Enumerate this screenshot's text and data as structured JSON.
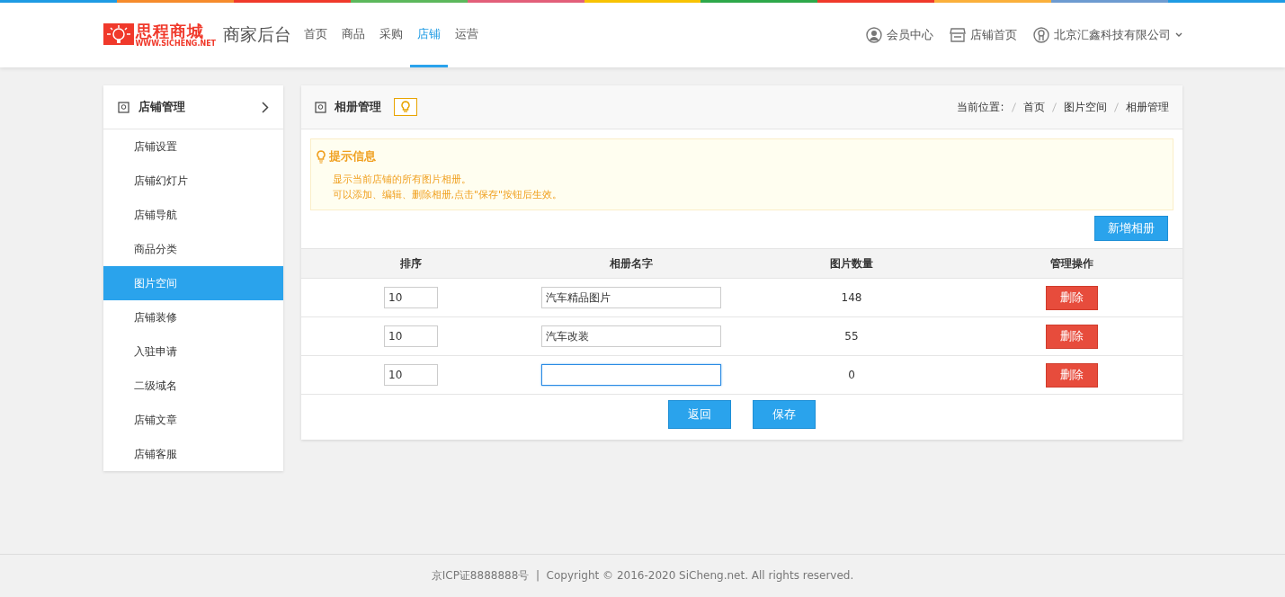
{
  "top_nav": {
    "logo": {
      "name": "思程商城",
      "url": "WWW.SICHENG.NET"
    },
    "title": "商家后台",
    "items": [
      {
        "label": "首页",
        "selected": false
      },
      {
        "label": "商品",
        "selected": false
      },
      {
        "label": "采购",
        "selected": false
      },
      {
        "label": "店铺",
        "selected": true
      },
      {
        "label": "运营",
        "selected": false
      }
    ],
    "links": [
      {
        "kind": "user",
        "label": "会员中心"
      },
      {
        "kind": "store",
        "label": "店铺首页"
      },
      {
        "kind": "account",
        "label": "北京汇鑫科技有限公司"
      }
    ]
  },
  "sidebar": {
    "title": "店铺管理",
    "items": [
      {
        "label": "店铺设置",
        "selected": false
      },
      {
        "label": "店铺幻灯片",
        "selected": false
      },
      {
        "label": "店铺导航",
        "selected": false
      },
      {
        "label": "商品分类",
        "selected": false
      },
      {
        "label": "图片空间",
        "selected": true
      },
      {
        "label": "店铺装修",
        "selected": false
      },
      {
        "label": "入驻申请",
        "selected": false
      },
      {
        "label": "二级域名",
        "selected": false
      },
      {
        "label": "店铺文章",
        "selected": false
      },
      {
        "label": "店铺客服",
        "selected": false
      }
    ]
  },
  "panel": {
    "title": "相册管理",
    "breadcrumb": {
      "label": "当前位置:",
      "items": [
        "首页",
        "图片空间",
        "相册管理"
      ]
    },
    "tips": {
      "title": "提示信息",
      "lines": [
        "显示当前店铺的所有图片相册。",
        "可以添加、编辑、删除相册,点击\"保存\"按钮后生效。"
      ]
    },
    "add_button": "新增相册",
    "table": {
      "columns": [
        "排序",
        "相册名字",
        "图片数量",
        "管理操作"
      ],
      "rows": [
        {
          "order": "10",
          "name": "汽车精品图片",
          "name_focused": false,
          "count": "148",
          "action": "删除"
        },
        {
          "order": "10",
          "name": "汽车改装",
          "name_focused": false,
          "count": "55",
          "action": "删除"
        },
        {
          "order": "10",
          "name_focused": true,
          "count": "0",
          "action": "删除"
        }
      ]
    },
    "buttons": [
      "返回",
      "保存"
    ]
  },
  "footer": "京ICP证8888888号  |  Copyright © 2016-2020 SiCheng.net. All rights reserved."
}
